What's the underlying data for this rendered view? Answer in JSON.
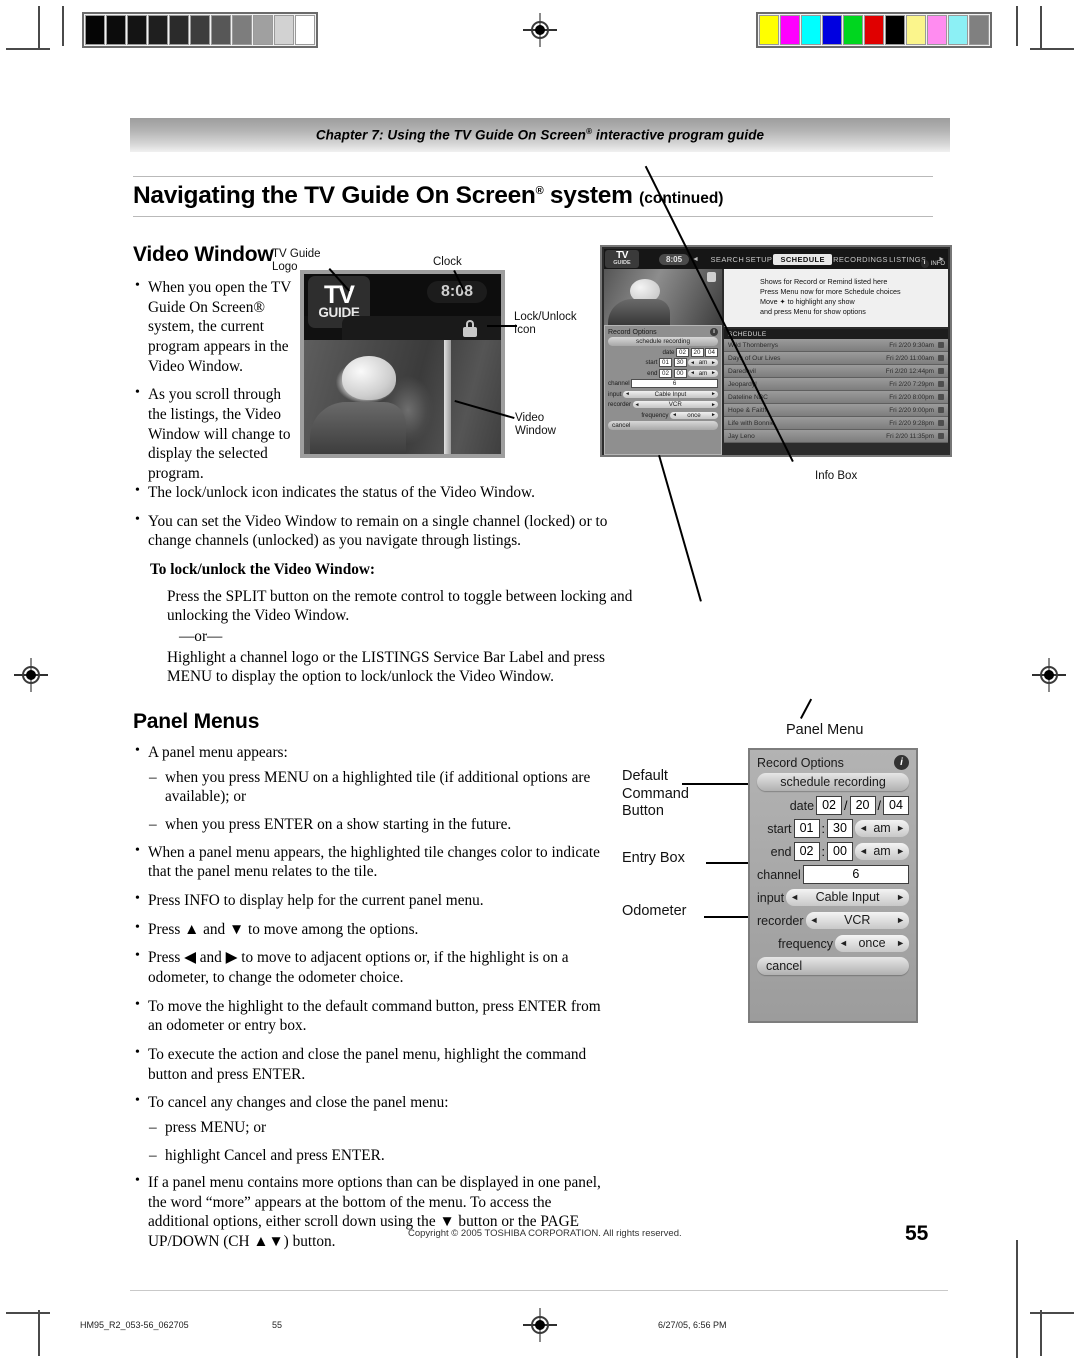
{
  "prepress": {
    "grayscale_bar": [
      "#050505",
      "#0c0c0c",
      "#141414",
      "#1f1f1f",
      "#2b2b2b",
      "#3d3d3d",
      "#575757",
      "#7d7d7d",
      "#a0a0a0",
      "#d2d2d2",
      "#ffffff"
    ],
    "color_bar": [
      "#ffff00",
      "#ff00ff",
      "#00ffff",
      "#0000e0",
      "#00d61f",
      "#e00000",
      "#000000",
      "#fbf58c",
      "#ff8cf0",
      "#8cf0f5",
      "#808080"
    ],
    "registration_mark": "registration-target"
  },
  "header": {
    "chapter": "Chapter 7: Using the TV Guide On Screen",
    "chapter_sup": "®",
    "chapter_tail": " interactive program guide",
    "title_main": "Navigating the TV Guide On Screen",
    "title_sup": "®",
    "title_tail": " system",
    "title_continued": "(continued)"
  },
  "video_window": {
    "heading": "Video Window",
    "bullets": [
      "When you open the TV Guide On Screen® system, the current program appears in the Video Window.",
      "As you scroll through the listings, the Video Window will change to display the selected program.",
      "The lock/unlock icon indicates the status of the Video Window.",
      "You can set the Video Window to remain on a single channel (locked) or to change channels (unlocked) as you navigate through listings."
    ],
    "sub_heading": "To lock/unlock the Video Window:",
    "para1": "Press the SPLIT button on the remote control to toggle between locking and unlocking the Video Window.",
    "or_divider": "—or—",
    "para2": "Highlight a channel logo or the LISTINGS Service Bar Label and press MENU to display the option to lock/unlock the Video Window."
  },
  "figure_video": {
    "callout_logo": "TV Guide\nLogo",
    "callout_clock": "Clock",
    "callout_lock": "Lock/Unlock\nIcon",
    "callout_video": "Video\nWindow",
    "logo_line1": "TV",
    "logo_line2": "GUIDE",
    "clock_time": "8:08"
  },
  "figure_osd": {
    "callout_info_box": "Info Box",
    "logo_line1": "TV",
    "logo_line2": "GUIDE",
    "clock_time": "8:05",
    "nav_items": [
      "SEARCH",
      "SETUP",
      "SCHEDULE",
      "RECORDINGS",
      "LISTINGS"
    ],
    "nav_selected": "SCHEDULE",
    "nav_left_arrow": "◄",
    "nav_right_arrow": "►",
    "info_tag_icon": "i",
    "info_tag_label": "INFO",
    "info_box_lines": [
      "Shows for Record or Remind listed here",
      "Press Menu now for more Schedule choices",
      "Move ✦ to highlight any show",
      "and press Menu for show options"
    ],
    "schedule_header": "SCHEDULE",
    "schedule_rows": [
      {
        "title": "Wild Thornberrys",
        "day": "Fri",
        "date": "2/20",
        "time": "9:30am"
      },
      {
        "title": "Days of Our Lives",
        "day": "Fri",
        "date": "2/20",
        "time": "11:00am"
      },
      {
        "title": "Daredevil",
        "day": "Fri",
        "date": "2/20",
        "time": "12:44pm"
      },
      {
        "title": "Jeopardy!",
        "day": "Fri",
        "date": "2/20",
        "time": "7:29pm"
      },
      {
        "title": "Dateline NBC",
        "day": "Fri",
        "date": "2/20",
        "time": "8:00pm"
      },
      {
        "title": "Hope & Faith",
        "day": "Fri",
        "date": "2/20",
        "time": "9:00pm"
      },
      {
        "title": "Life with Bonnie",
        "day": "Fri",
        "date": "2/20",
        "time": "9:28pm"
      },
      {
        "title": "Jay Leno",
        "day": "Fri",
        "date": "2/20",
        "time": "11:35pm"
      }
    ],
    "mini_panel": {
      "title": "Record Options",
      "info_icon": "i",
      "command": "schedule recording",
      "date_label": "date",
      "date_mm": "02",
      "date_dd": "20",
      "date_yy": "04",
      "start_label": "start",
      "start_hh": "01",
      "start_mm": "30",
      "start_ampm": "am",
      "end_label": "end",
      "end_hh": "02",
      "end_mm": "00",
      "end_ampm": "am",
      "channel_label": "channel",
      "channel_value": "6",
      "input_label": "input",
      "input_value": "Cable Input",
      "recorder_label": "recorder",
      "recorder_value": "VCR",
      "frequency_label": "frequency",
      "frequency_value": "once",
      "cancel": "cancel"
    }
  },
  "panel_menus": {
    "heading": "Panel Menus",
    "bullet1": "A panel menu appears:",
    "sub1": "when you press MENU on a highlighted tile (if additional options are available); or",
    "sub2": "when you press ENTER on a show starting in the future.",
    "bullet2": "When a panel menu appears, the highlighted tile changes color to indicate that the panel menu relates to the tile.",
    "bullet3": "Press INFO to display help for the current panel menu.",
    "bullet4_a": "Press ",
    "bullet4_up": "▲",
    "bullet4_b": " and ",
    "bullet4_dn": "▼",
    "bullet4_c": " to move among the options.",
    "bullet5_a": "Press ",
    "bullet5_lt": "◀",
    "bullet5_b": " and ",
    "bullet5_rt": "▶",
    "bullet5_c": " to move to adjacent options or, if the highlight is on a odometer, to change the odometer choice.",
    "bullet6": "To move the highlight to the default command button, press ENTER from an odometer or entry box.",
    "bullet7": "To execute the action and close the panel menu, highlight the command button and press ENTER.",
    "bullet8": "To cancel any changes and close the panel menu:",
    "sub3": "press MENU; or",
    "sub4": "highlight Cancel and press ENTER.",
    "bullet9_a": "If a panel menu contains more options than can be displayed in one panel, the word “more” appears at the bottom of the menu. To access the additional options, either scroll down using the ",
    "bullet9_dn": "▼",
    "bullet9_b": " button or the PAGE UP/DOWN (CH ",
    "bullet9_updn": "▲▼",
    "bullet9_c": ") button."
  },
  "figure_panel_menu": {
    "callout_title": "Panel Menu",
    "callout_default": "Default\nCommand\nButton",
    "callout_entry": "Entry Box",
    "callout_odometer": "Odometer",
    "title": "Record Options",
    "info_icon": "i",
    "command": "schedule recording",
    "date_label": "date",
    "date_mm": "02",
    "date_dd": "20",
    "date_yy": "04",
    "date_sep": "/",
    "start_label": "start",
    "start_hh": "01",
    "start_mm": "30",
    "start_ampm": "am",
    "time_sep": ":",
    "end_label": "end",
    "end_hh": "02",
    "end_mm": "00",
    "end_ampm": "am",
    "channel_label": "channel",
    "channel_value": "6",
    "input_label": "input",
    "input_value": "Cable Input",
    "recorder_label": "recorder",
    "recorder_value": "VCR",
    "frequency_label": "frequency",
    "frequency_value": "once",
    "cancel": "cancel",
    "arrow_left": "◄",
    "arrow_right": "►"
  },
  "footer": {
    "copyright": "Copyright © 2005 TOSHIBA CORPORATION. All rights reserved.",
    "page_number": "55",
    "slug_file": "HM95_R2_053-56_062705",
    "slug_page": "55",
    "slug_date": "6/27/05, 6:56 PM"
  }
}
